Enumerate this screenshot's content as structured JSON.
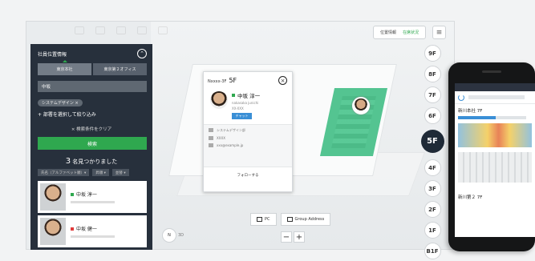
{
  "sidebar": {
    "title": "社員位置情報",
    "tabs": [
      "東京本社",
      "東京第２オフィス"
    ],
    "search_value": "中坂",
    "chip": "システムデザイン ×",
    "add_department": "+ 部署を選択して絞り込み",
    "clear": "× 検索条件をクリア",
    "search_button": "検索",
    "result_count": "3",
    "result_suffix": "名見つかりました",
    "filters": [
      "氏名（アルファベット順）▾",
      "昇順 ▾",
      "並替 ▾"
    ],
    "people": [
      {
        "name": "中坂 淳一",
        "status_color": "#2fa84f"
      },
      {
        "name": "中坂 健一",
        "status_color": "#e03a3a"
      }
    ]
  },
  "toolbar": {
    "label": "位置情報",
    "status": "在席状況"
  },
  "popup": {
    "location": "Nxxxx-3F",
    "floor": "5F",
    "person_name": "中坂 淳一",
    "person_kana": "nakasaka junichi",
    "extension": "XX-XXX",
    "button": "チャット",
    "details": [
      {
        "label": "所属",
        "value": "システムデザイン部"
      },
      {
        "label": "内線番号",
        "value": "XXXX"
      },
      {
        "label": "メール",
        "value": "xxx@example.jp"
      }
    ],
    "follow": "フォローする"
  },
  "floors": [
    "9F",
    "8F",
    "7F",
    "6F",
    "5F",
    "4F",
    "3F",
    "2F",
    "1F",
    "B1F"
  ],
  "active_floor": "5F",
  "bottom": {
    "pc_button": "PC",
    "group_button": "Group Address",
    "zoom_out": "−",
    "zoom_in": "+",
    "compass": "N",
    "compass_label": "3D"
  },
  "phone": {
    "floor_label_1": "新川本社 7F",
    "floor_label_2": "新川第２ 7F",
    "progress_pct": 55
  },
  "colors": {
    "accent_green": "#2fa84f",
    "sidebar_bg": "#27303c",
    "active_floor_bg": "#1f2a37",
    "map_green": "#54c491",
    "link_blue": "#3a8fd6"
  }
}
